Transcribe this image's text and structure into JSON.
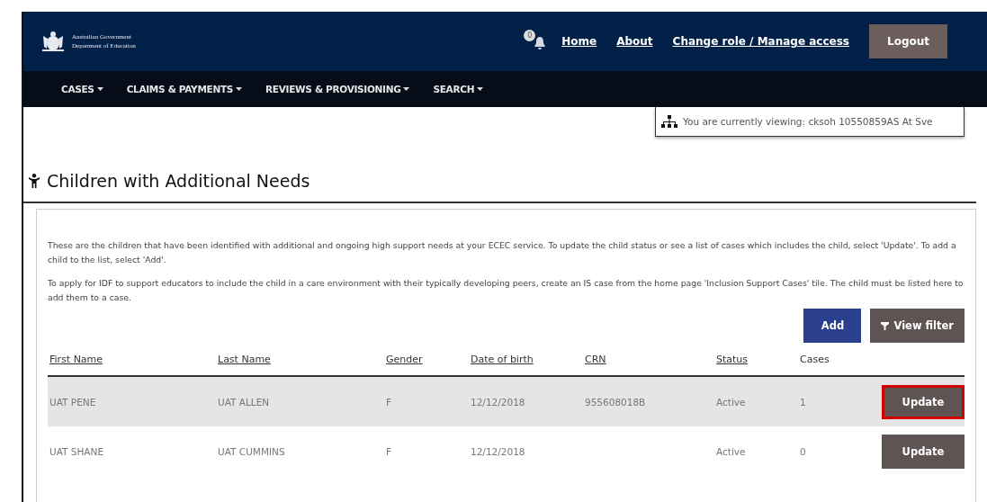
{
  "header": {
    "logo_lines": [
      "Australian Government",
      "Department of Education"
    ],
    "notification_count": "0",
    "links": [
      "Home",
      "About",
      "Change role / Manage access"
    ],
    "logout": "Logout"
  },
  "nav": [
    "CASES",
    "CLAIMS & PAYMENTS",
    "REVIEWS & PROVISIONING",
    "SEARCH"
  ],
  "viewing": "You are currently viewing: cksoh 10550859AS At Sve",
  "page_title": "Children with Additional Needs",
  "paragraphs": [
    "These are the children that have been identified with additional and ongoing high support needs at your ECEC service. To update the child status or see a list of cases which includes the child, select 'Update'. To add a child to the list, select 'Add'.",
    "To apply for IDF to support educators to include the child in a care environment with their typically developing peers, create an IS case from the home page 'Inclusion Support Cases' tile. The child must be listed here to add them to a case."
  ],
  "actions": {
    "add": "Add",
    "filter": "View filter"
  },
  "table": {
    "columns": [
      {
        "label": "First Name",
        "sortable": true
      },
      {
        "label": "Last Name",
        "sortable": true
      },
      {
        "label": "Gender",
        "sortable": true
      },
      {
        "label": "Date of birth",
        "sortable": true
      },
      {
        "label": "CRN",
        "sortable": true
      },
      {
        "label": "Status",
        "sortable": true
      },
      {
        "label": "Cases",
        "sortable": false
      }
    ],
    "rows": [
      {
        "cells": [
          "UAT PENE",
          "UAT ALLEN",
          "F",
          "12/12/2018",
          "955608018B",
          "Active",
          "1"
        ],
        "button": "Update",
        "selected": true
      },
      {
        "cells": [
          "UAT SHANE",
          "UAT CUMMINS",
          "F",
          "12/12/2018",
          "",
          "Active",
          "0"
        ],
        "button": "Update",
        "selected": false
      }
    ]
  }
}
